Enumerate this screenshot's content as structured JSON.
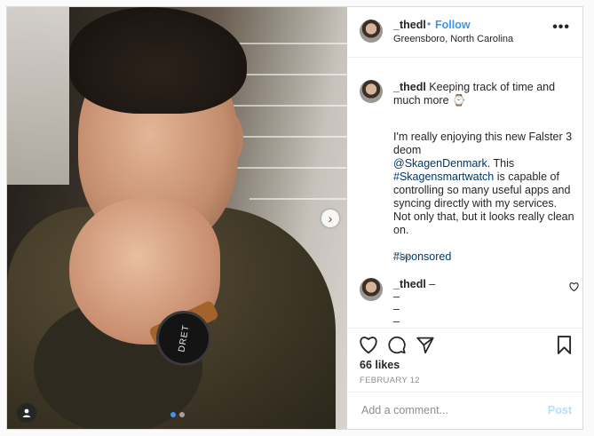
{
  "post": {
    "username": "_thedl",
    "follow_bullet": "•",
    "follow_label": "Follow",
    "location": "Greensboro, North Carolina",
    "more_icon": "more-horizontal-icon",
    "more_label": "•••"
  },
  "photo": {
    "watch_text": "DRET",
    "next_label": "›",
    "carousel": {
      "count": 2,
      "active": 1
    }
  },
  "caption": {
    "username": "_thedl",
    "headline": "Keeping track of time and much more ⌚",
    "body_1": "I'm really enjoying this new Falster 3 deom",
    "mention": "@SkagenDenmark",
    "body_2": ". This",
    "hashtag": "#Skagensmartwatch",
    "body_3": " is capable of controlling so many useful apps and syncing directly with my services. Not only that, but it looks really clean on.",
    "tag_sponsored": "#sponsored",
    "age": "31w"
  },
  "reply": {
    "username": "_thedl",
    "dash_1": "–",
    "dash_2": "–",
    "dash_3": "–",
    "dash_4": "–"
  },
  "engagement": {
    "likes": "66 likes",
    "date": "FEBRUARY 12"
  },
  "composer": {
    "placeholder": "Add a comment...",
    "post_label": "Post"
  },
  "colors": {
    "accent": "#3897f0",
    "link": "#00376b",
    "muted": "#8e8e8e",
    "post_disabled": "#b2dffc"
  }
}
